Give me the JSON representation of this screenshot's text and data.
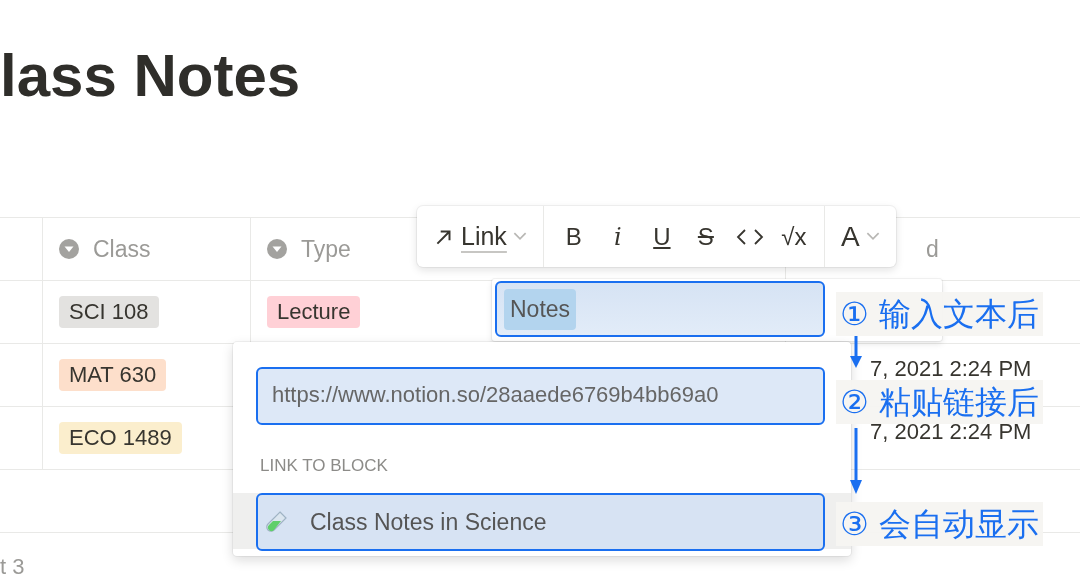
{
  "title": "lass Notes",
  "table": {
    "columns": [
      {},
      {
        "label": "Class",
        "icon": true
      },
      {
        "label": "Type",
        "icon": true
      },
      {},
      {
        "label": "d"
      }
    ],
    "rows": [
      {
        "class": {
          "text": "SCI 108",
          "color": "#e3e2e0"
        },
        "type": {
          "text": "Lecture",
          "color": "#ffd0d6"
        },
        "date": ""
      },
      {
        "class": {
          "text": "MAT 630",
          "color": "#fddfcb"
        },
        "type": null,
        "date": "7, 2021 2:24 PM"
      },
      {
        "class": {
          "text": "ECO 1489",
          "color": "#fbeecd"
        },
        "type": null,
        "date": "7, 2021 2:24 PM"
      }
    ],
    "footer": "t 3"
  },
  "editor": {
    "value": "Notes"
  },
  "toolbar": {
    "link": "Link",
    "buttons": [
      {
        "kind": "bold",
        "label": "B"
      },
      {
        "kind": "italic",
        "label": "i"
      },
      {
        "kind": "underline",
        "label": "U"
      },
      {
        "kind": "strike",
        "label": "S"
      },
      {
        "kind": "code"
      },
      {
        "kind": "math",
        "label": "√x"
      }
    ],
    "color_label": "A"
  },
  "popup": {
    "url": "https://www.notion.so/28aaede6769b4bb69a0",
    "section": "LINK TO BLOCK",
    "items": [
      {
        "label": "Class Notes in Science",
        "selected": true
      }
    ]
  },
  "annotations": [
    {
      "number": "①",
      "text": "输入文本后"
    },
    {
      "number": "②",
      "text": "粘贴链接后"
    },
    {
      "number": "③",
      "text": "会自动显示"
    }
  ]
}
